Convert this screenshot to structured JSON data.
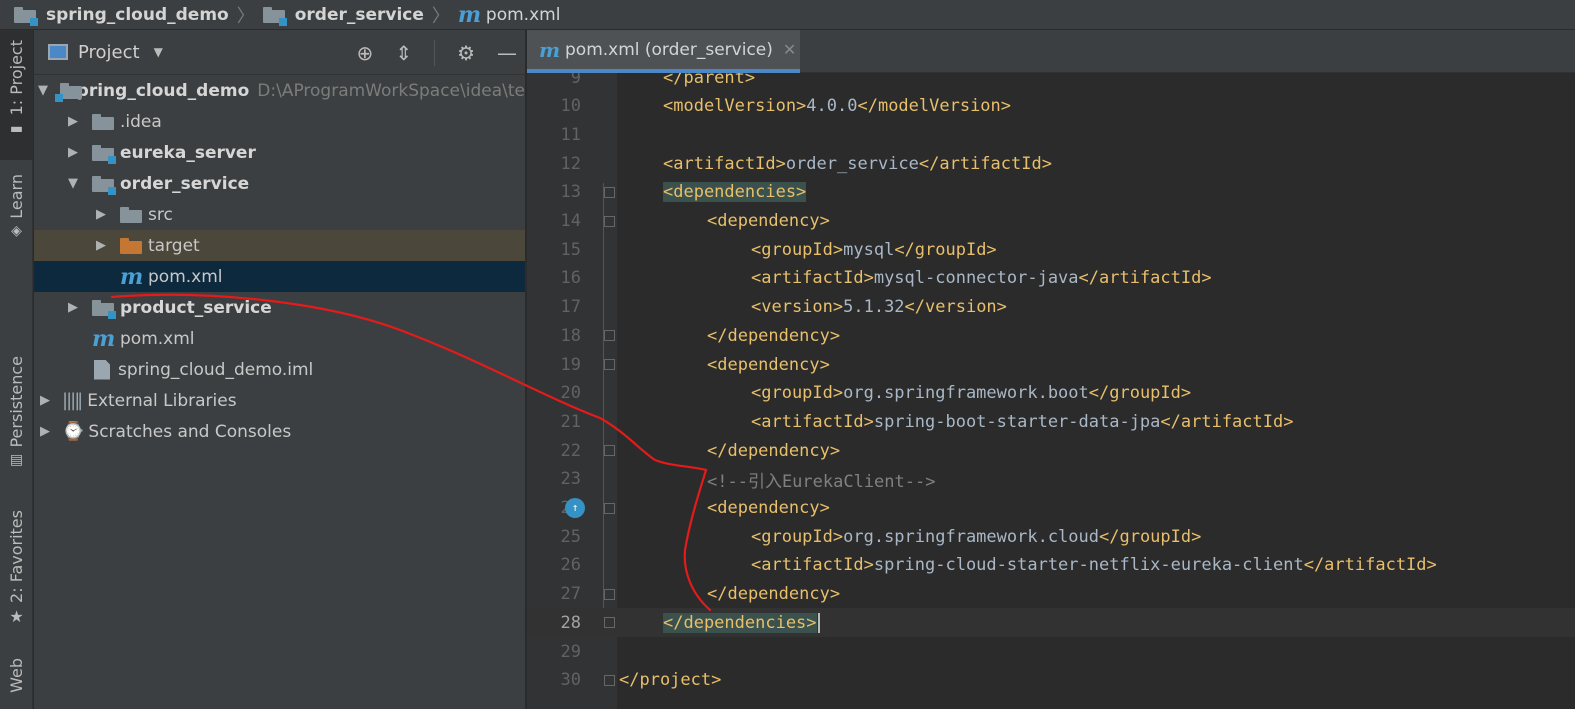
{
  "breadcrumb": {
    "items": [
      {
        "label": "spring_cloud_demo",
        "icon": "module-folder-icon"
      },
      {
        "label": "order_service",
        "icon": "module-folder-icon"
      },
      {
        "label": "pom.xml",
        "icon": "maven-icon"
      }
    ]
  },
  "tool_stripe": {
    "items": [
      "1: Project",
      "Learn",
      "Persistence",
      "2: Favorites",
      "Web"
    ]
  },
  "project_panel": {
    "title": "Project",
    "tree": [
      {
        "label": "spring_cloud_demo",
        "path": "D:\\AProgramWorkSpace\\idea\\te",
        "bold": true,
        "expanded": true
      },
      {
        "label": ".idea",
        "bold": false
      },
      {
        "label": "eureka_server",
        "bold": true
      },
      {
        "label": "order_service",
        "bold": true,
        "expanded": true
      },
      {
        "label": "src",
        "bold": false
      },
      {
        "label": "target",
        "bold": false
      },
      {
        "label": "pom.xml",
        "bold": false,
        "selected": true
      },
      {
        "label": "product_service",
        "bold": true
      },
      {
        "label": "pom.xml",
        "bold": false
      },
      {
        "label": "spring_cloud_demo.iml",
        "bold": false
      },
      {
        "label": "External Libraries",
        "bold": false
      },
      {
        "label": "Scratches and Consoles",
        "bold": false
      }
    ]
  },
  "editor": {
    "tab_label": "pom.xml (order_service)",
    "current_line": 28,
    "lines": [
      {
        "n": "9",
        "text": "</parent>"
      },
      {
        "n": "10",
        "text": "<modelVersion>4.0.0</modelVersion>"
      },
      {
        "n": "11",
        "text": ""
      },
      {
        "n": "12",
        "text": "<artifactId>order_service</artifactId>"
      },
      {
        "n": "13",
        "text": "<dependencies>"
      },
      {
        "n": "14",
        "text": "<dependency>"
      },
      {
        "n": "15",
        "text": "<groupId>mysql</groupId>"
      },
      {
        "n": "16",
        "text": "<artifactId>mysql-connector-java</artifactId>"
      },
      {
        "n": "17",
        "text": "<version>5.1.32</version>"
      },
      {
        "n": "18",
        "text": "</dependency>"
      },
      {
        "n": "19",
        "text": "<dependency>"
      },
      {
        "n": "20",
        "text": "<groupId>org.springframework.boot</groupId>"
      },
      {
        "n": "21",
        "text": "<artifactId>spring-boot-starter-data-jpa</artifactId>"
      },
      {
        "n": "22",
        "text": "</dependency>"
      },
      {
        "n": "23",
        "text": "<!--引入EurekaClient-->"
      },
      {
        "n": "24",
        "text": "<dependency>"
      },
      {
        "n": "25",
        "text": "<groupId>org.springframework.cloud</groupId>"
      },
      {
        "n": "26",
        "text": "<artifactId>spring-cloud-starter-netflix-eureka-client</artifactId>"
      },
      {
        "n": "27",
        "text": "</dependency>"
      },
      {
        "n": "28",
        "text": "</dependencies>"
      },
      {
        "n": "29",
        "text": ""
      },
      {
        "n": "30",
        "text": "</project>"
      }
    ]
  },
  "colors": {
    "tag": "#e8bf6a",
    "text": "#a9b7c6",
    "comment": "#808080",
    "annotation": "#e31b1b",
    "accent": "#4a88c7"
  }
}
